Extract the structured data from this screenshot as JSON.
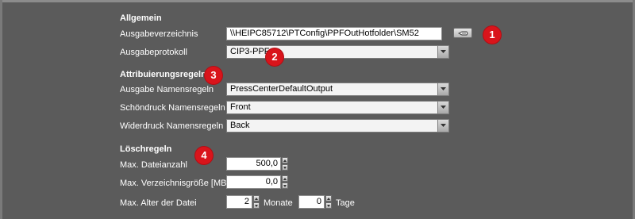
{
  "allgemein": {
    "title": "Allgemein",
    "output_dir_label": "Ausgabeverzeichnis",
    "output_dir_value": "\\\\HEIPC85712\\PTConfig\\PPFOutHotfolder\\SM52",
    "protocol_label": "Ausgabeprotokoll",
    "protocol_value": "CIP3-PPF",
    "browse_icon": "hand-pointer-icon"
  },
  "naming": {
    "title": "Attribuierungsregeln",
    "output_label": "Ausgabe Namensregeln",
    "output_value": "PressCenterDefaultOutput",
    "front_label": "Schöndruck Namensregeln",
    "front_value": "Front",
    "back_label": "Widerdruck Namensregeln",
    "back_value": "Back"
  },
  "delete": {
    "title": "Löschregeln",
    "max_files_label": "Max. Dateianzahl",
    "max_files_value": "500,0",
    "max_dir_size_label": "Max. Verzeichnisgröße [MB]",
    "max_dir_size_value": "0,0",
    "max_age_label": "Max. Alter der Datei",
    "months_value": "2",
    "months_unit": "Monate",
    "days_value": "0",
    "days_unit": "Tage"
  },
  "markers": [
    "1",
    "2",
    "3",
    "4"
  ],
  "colors": {
    "background": "#5b5b5b",
    "marker": "#d9141b"
  }
}
